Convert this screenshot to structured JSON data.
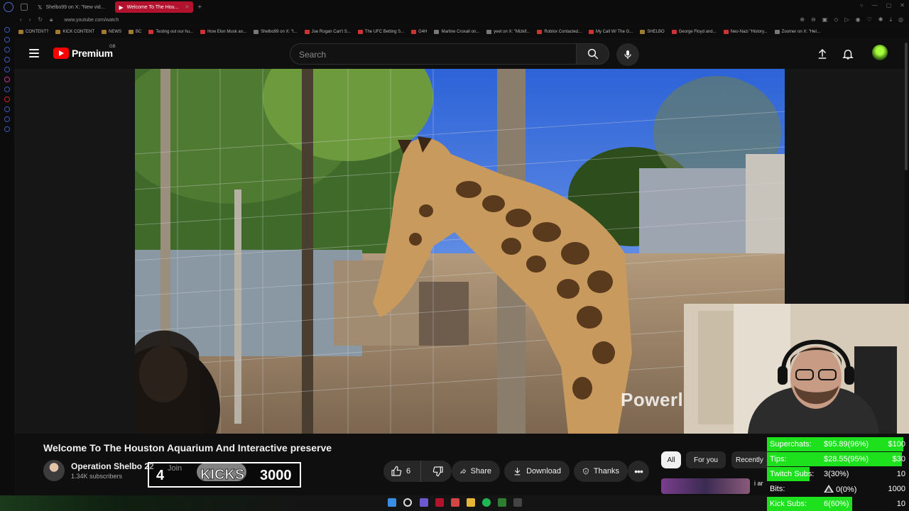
{
  "browser": {
    "tabs": [
      {
        "label": "Shelbo99 on X: \"New vid...",
        "active": false
      },
      {
        "label": "Welcome To The Hou...",
        "active": true
      }
    ],
    "url": "www.youtube.com/watch",
    "bookmarks": [
      "CONTENT?",
      "KICK CONTENT",
      "NEWS",
      "BC",
      "Testing out our hu...",
      "How Elon Musk an...",
      "Shelbo99 on X: \"I...",
      "Joe Rogan Can't S...",
      "The UFC Betting S...",
      "G4H",
      "Martine Croxall on...",
      "yeet on X: \"Mizkif...",
      "Roblox Contacted...",
      "My Call W/ The G...",
      "SHELBO",
      "George Floyd and...",
      "Neo-Nazi \"History...",
      "Zoomer on X: \"Hel..."
    ]
  },
  "header": {
    "logo_text": "Premium",
    "logo_country": "GB",
    "search_placeholder": "Search"
  },
  "video": {
    "overlay_text": "Powerl",
    "title": "Welcome To The Houston Aquarium And Interactive preserve"
  },
  "channel": {
    "name": "Operation Shelbo 22",
    "subscribers": "1.34K subscribers",
    "join_label": "Join"
  },
  "kicks": {
    "count": "4",
    "label": "KICKS",
    "target": "3000"
  },
  "actions": {
    "like_count": "6",
    "share_label": "Share",
    "download_label": "Download",
    "thanks_label": "Thanks"
  },
  "chips": {
    "all": "All",
    "for_you": "For you",
    "recently": "Recently"
  },
  "recommendation": {
    "title_fragment": "i ar"
  },
  "stats": [
    {
      "label": "Superchats:",
      "value": "$95.89(96%)",
      "goal": "$100",
      "progress": 0.96
    },
    {
      "label": "Tips:",
      "value": "$28.55(95%)",
      "goal": "$30",
      "progress": 0.95
    },
    {
      "label": "Twitch Subs:",
      "value": "3(30%)",
      "goal": "10",
      "progress": 0.3
    },
    {
      "label": "Bits:",
      "value": "0(0%)",
      "goal": "1000",
      "progress": 0.0
    },
    {
      "label": "Kick Subs:",
      "value": "6(60%)",
      "goal": "10",
      "progress": 0.6
    }
  ],
  "colors": {
    "youtube_red": "#ff0000",
    "active_tab": "#b3122e",
    "progress_green": "#1ee11e",
    "background": "#0f0f0f"
  },
  "icons": [
    "menu-icon",
    "search-icon",
    "mic-icon",
    "upload-icon",
    "bell-icon",
    "like-icon",
    "dislike-icon",
    "share-icon",
    "download-icon",
    "thanks-icon",
    "more-icon"
  ]
}
